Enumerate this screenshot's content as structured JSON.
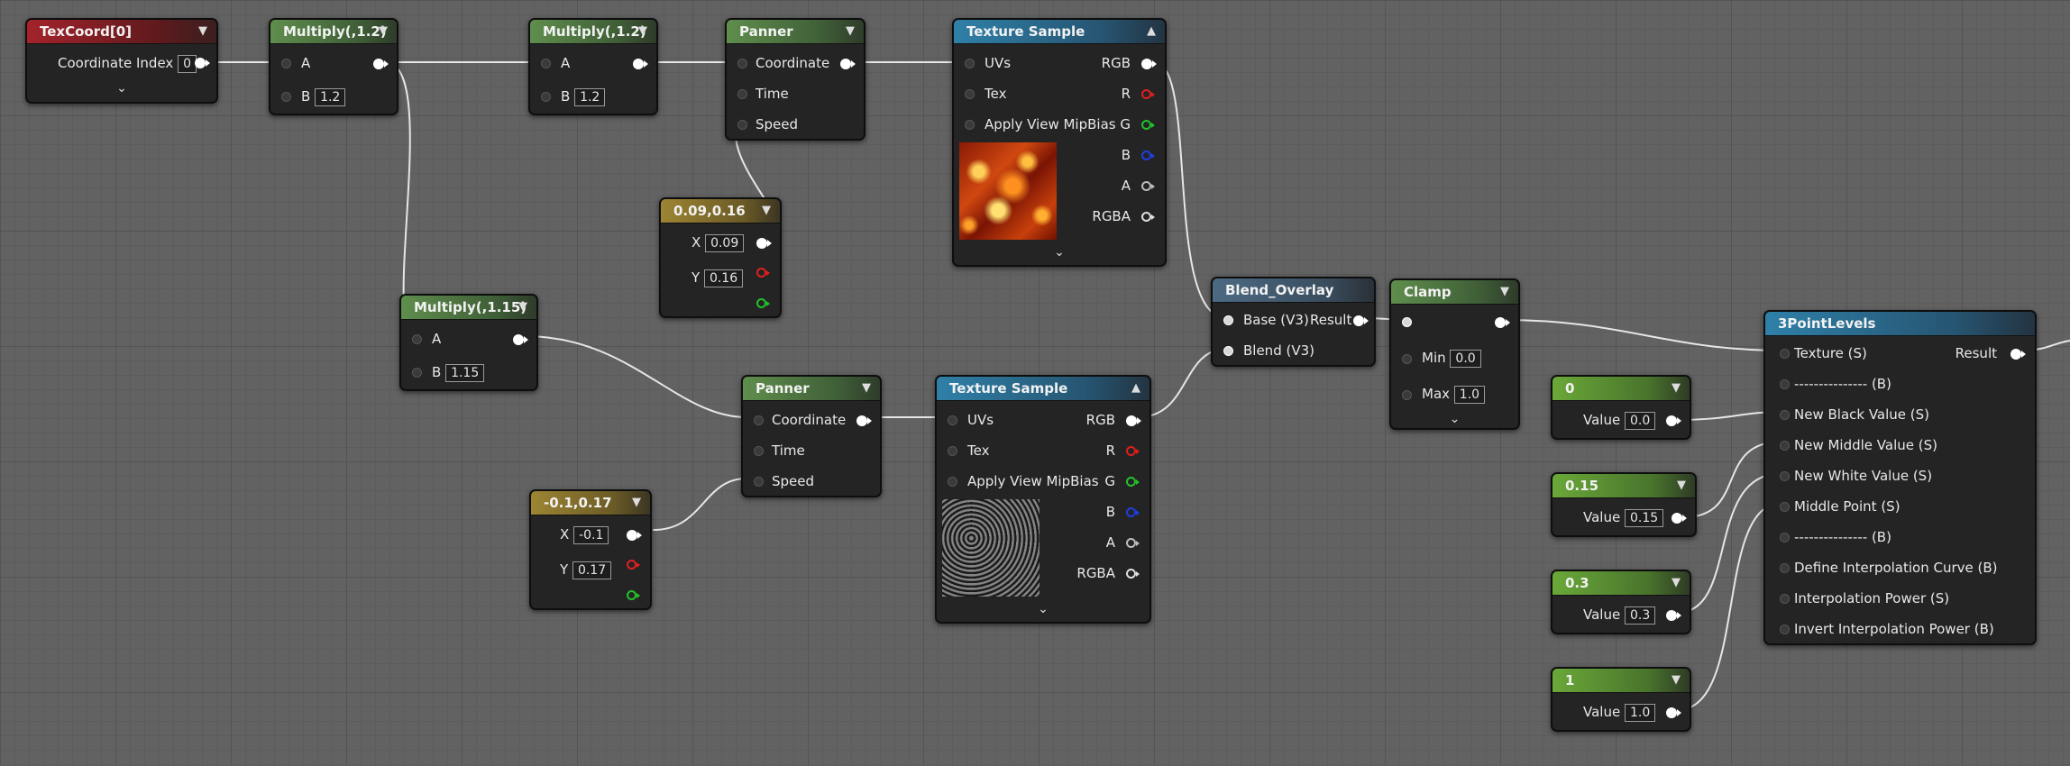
{
  "nodes": {
    "texcoord": {
      "title": "TexCoord[0]",
      "coord_label": "Coordinate Index",
      "coord_value": "0"
    },
    "mul1": {
      "title": "Multiply(,1.2)",
      "a_label": "A",
      "b_label": "B",
      "b_value": "1.2"
    },
    "mul2": {
      "title": "Multiply(,1.2)",
      "a_label": "A",
      "b_label": "B",
      "b_value": "1.2"
    },
    "panner1": {
      "title": "Panner",
      "coordinate": "Coordinate",
      "time": "Time",
      "speed": "Speed"
    },
    "tex1": {
      "title": "Texture Sample",
      "uvs": "UVs",
      "tex": "Tex",
      "mip": "Apply View MipBias",
      "rgb": "RGB",
      "r": "R",
      "g": "G",
      "b": "B",
      "a": "A",
      "rgba": "RGBA"
    },
    "const1": {
      "title": "0.09,0.16",
      "x_label": "X",
      "x_value": "0.09",
      "y_label": "Y",
      "y_value": "0.16"
    },
    "mul3": {
      "title": "Multiply(,1.15)",
      "a_label": "A",
      "b_label": "B",
      "b_value": "1.15"
    },
    "panner2": {
      "title": "Panner",
      "coordinate": "Coordinate",
      "time": "Time",
      "speed": "Speed"
    },
    "tex2": {
      "title": "Texture Sample",
      "uvs": "UVs",
      "tex": "Tex",
      "mip": "Apply View MipBias",
      "rgb": "RGB",
      "r": "R",
      "g": "G",
      "b": "B",
      "a": "A",
      "rgba": "RGBA"
    },
    "const2": {
      "title": "-0.1,0.17",
      "x_label": "X",
      "x_value": "-0.1",
      "y_label": "Y",
      "y_value": "0.17"
    },
    "blend": {
      "title": "Blend_Overlay",
      "base": "Base (V3)",
      "blend": "Blend (V3)",
      "result": "Result"
    },
    "clamp": {
      "title": "Clamp",
      "min_label": "Min",
      "min_value": "0.0",
      "max_label": "Max",
      "max_value": "1.0"
    },
    "s0": {
      "title": "0",
      "label": "Value",
      "value": "0.0"
    },
    "s1": {
      "title": "0.15",
      "label": "Value",
      "value": "0.15"
    },
    "s2": {
      "title": "0.3",
      "label": "Value",
      "value": "0.3"
    },
    "s3": {
      "title": "1",
      "label": "Value",
      "value": "1.0"
    },
    "levels": {
      "title": "3PointLevels",
      "result": "Result",
      "inputs": [
        "Texture (S)",
        "--------------- (B)",
        "New Black Value (S)",
        "New Middle Value (S)",
        "New White Value (S)",
        "Middle Point (S)",
        "---------------  (B)",
        "Define Interpolation Curve (B)",
        "Interpolation Power (S)",
        "Invert Interpolation Power (B)"
      ]
    }
  },
  "colors": {
    "wire": "#e6e6e6",
    "pin_r": "#e01f1f",
    "pin_g": "#22c22a",
    "pin_b": "#1f3ee0"
  }
}
